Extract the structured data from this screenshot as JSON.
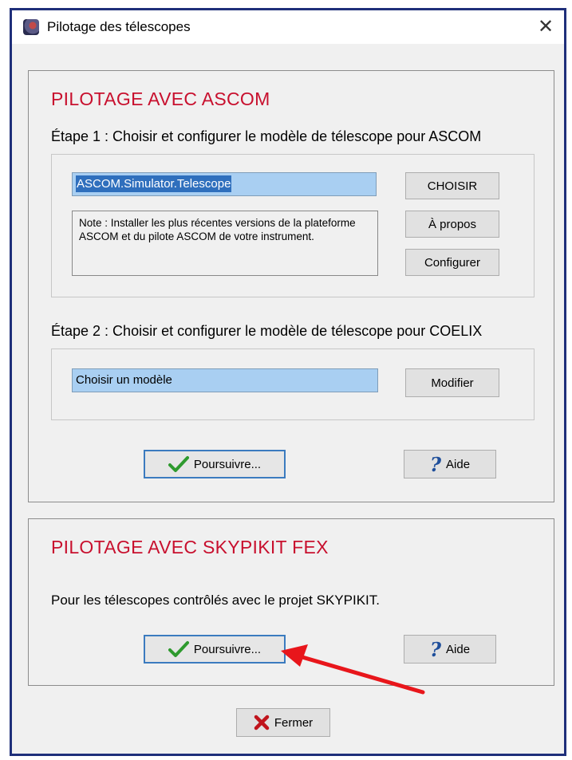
{
  "window": {
    "title": "Pilotage des télescopes",
    "close_glyph": "✕"
  },
  "ascom": {
    "title": "PILOTAGE AVEC ASCOM",
    "step1_label": "Étape 1 : Choisir et configurer le modèle de télescope pour ASCOM",
    "driver_value": "ASCOM.Simulator.Telescope",
    "note": "Note : Installer les plus récentes versions de la plateforme ASCOM et du pilote ASCOM de votre instrument.",
    "choose_button": "CHOISIR",
    "about_button": "À propos",
    "configure_button": "Configurer",
    "step2_label": "Étape 2 : Choisir et configurer le modèle de télescope pour COELIX",
    "model_value": "Choisir un modèle",
    "modify_button": "Modifier",
    "continue_button": "Poursuivre...",
    "help_button": "Aide"
  },
  "skypikit": {
    "title": "PILOTAGE AVEC SKYPIKIT FEX",
    "description": "Pour les télescopes contrôlés avec le projet SKYPIKIT.",
    "continue_button": "Poursuivre...",
    "help_button": "Aide"
  },
  "footer": {
    "close_button": "Fermer"
  },
  "icons": {
    "app": "telescope-app-icon",
    "check": "check-icon",
    "help": "question-mark-icon",
    "close": "red-x-icon",
    "annotation": "red-arrow-annotation"
  },
  "colors": {
    "section_title": "#c8102e",
    "window_border": "#1f2f7a",
    "selection": "#2f6fbd",
    "field_bg": "#a9cff2",
    "check": "#2e9a2e",
    "help": "#1f4f9b",
    "close_x": "#c0141c",
    "arrow": "#e8161b"
  }
}
